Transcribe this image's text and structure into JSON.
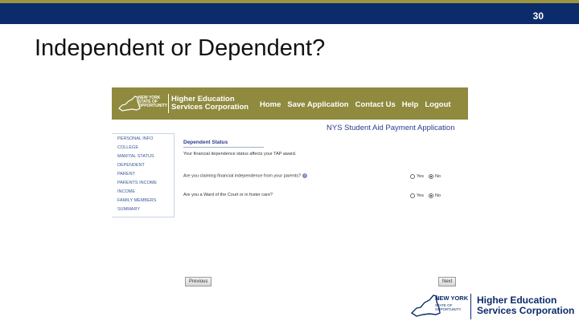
{
  "slide": {
    "number": "30",
    "title": "Independent or Dependent?"
  },
  "header": {
    "nys_logo_text": "NEW YORK STATE OF OPPORTUNITY",
    "org_line1": "Higher Education",
    "org_line2": "Services Corporation",
    "nav": [
      "Home",
      "Save Application",
      "Contact Us",
      "Help",
      "Logout"
    ]
  },
  "app_title": "NYS Student Aid Payment Application",
  "sidebar": {
    "items": [
      "Personal Info",
      "College",
      "Marital Status",
      "Dependent",
      "Parent",
      "Parents Income",
      "Income",
      "Family Members",
      "Summary"
    ]
  },
  "section": {
    "title": "Dependent Status",
    "intro": "Your financial dependence status affects your TAP award.",
    "questions": [
      {
        "text": "Are you claiming financial independence from your parents?",
        "yes_label": "Yes",
        "no_label": "No",
        "selected": "No"
      },
      {
        "text": "Are you a Ward of the Court or in foster care?",
        "yes_label": "Yes",
        "no_label": "No",
        "selected": "No"
      }
    ]
  },
  "buttons": {
    "previous": "Previous",
    "next": "Next"
  },
  "footer_logo": {
    "nys_line1": "NEW YORK",
    "nys_line2": "STATE OF OPPORTUNITY.",
    "org_line1": "Higher Education",
    "org_line2": "Services Corporation"
  },
  "colors": {
    "top_bar": "#0b2b6b",
    "top_bar_accent": "#9c9440",
    "header_bg": "#8f8a3e",
    "link_blue": "#3a5a9a"
  },
  "icons": [
    "info-icon",
    "nys-state-icon"
  ]
}
